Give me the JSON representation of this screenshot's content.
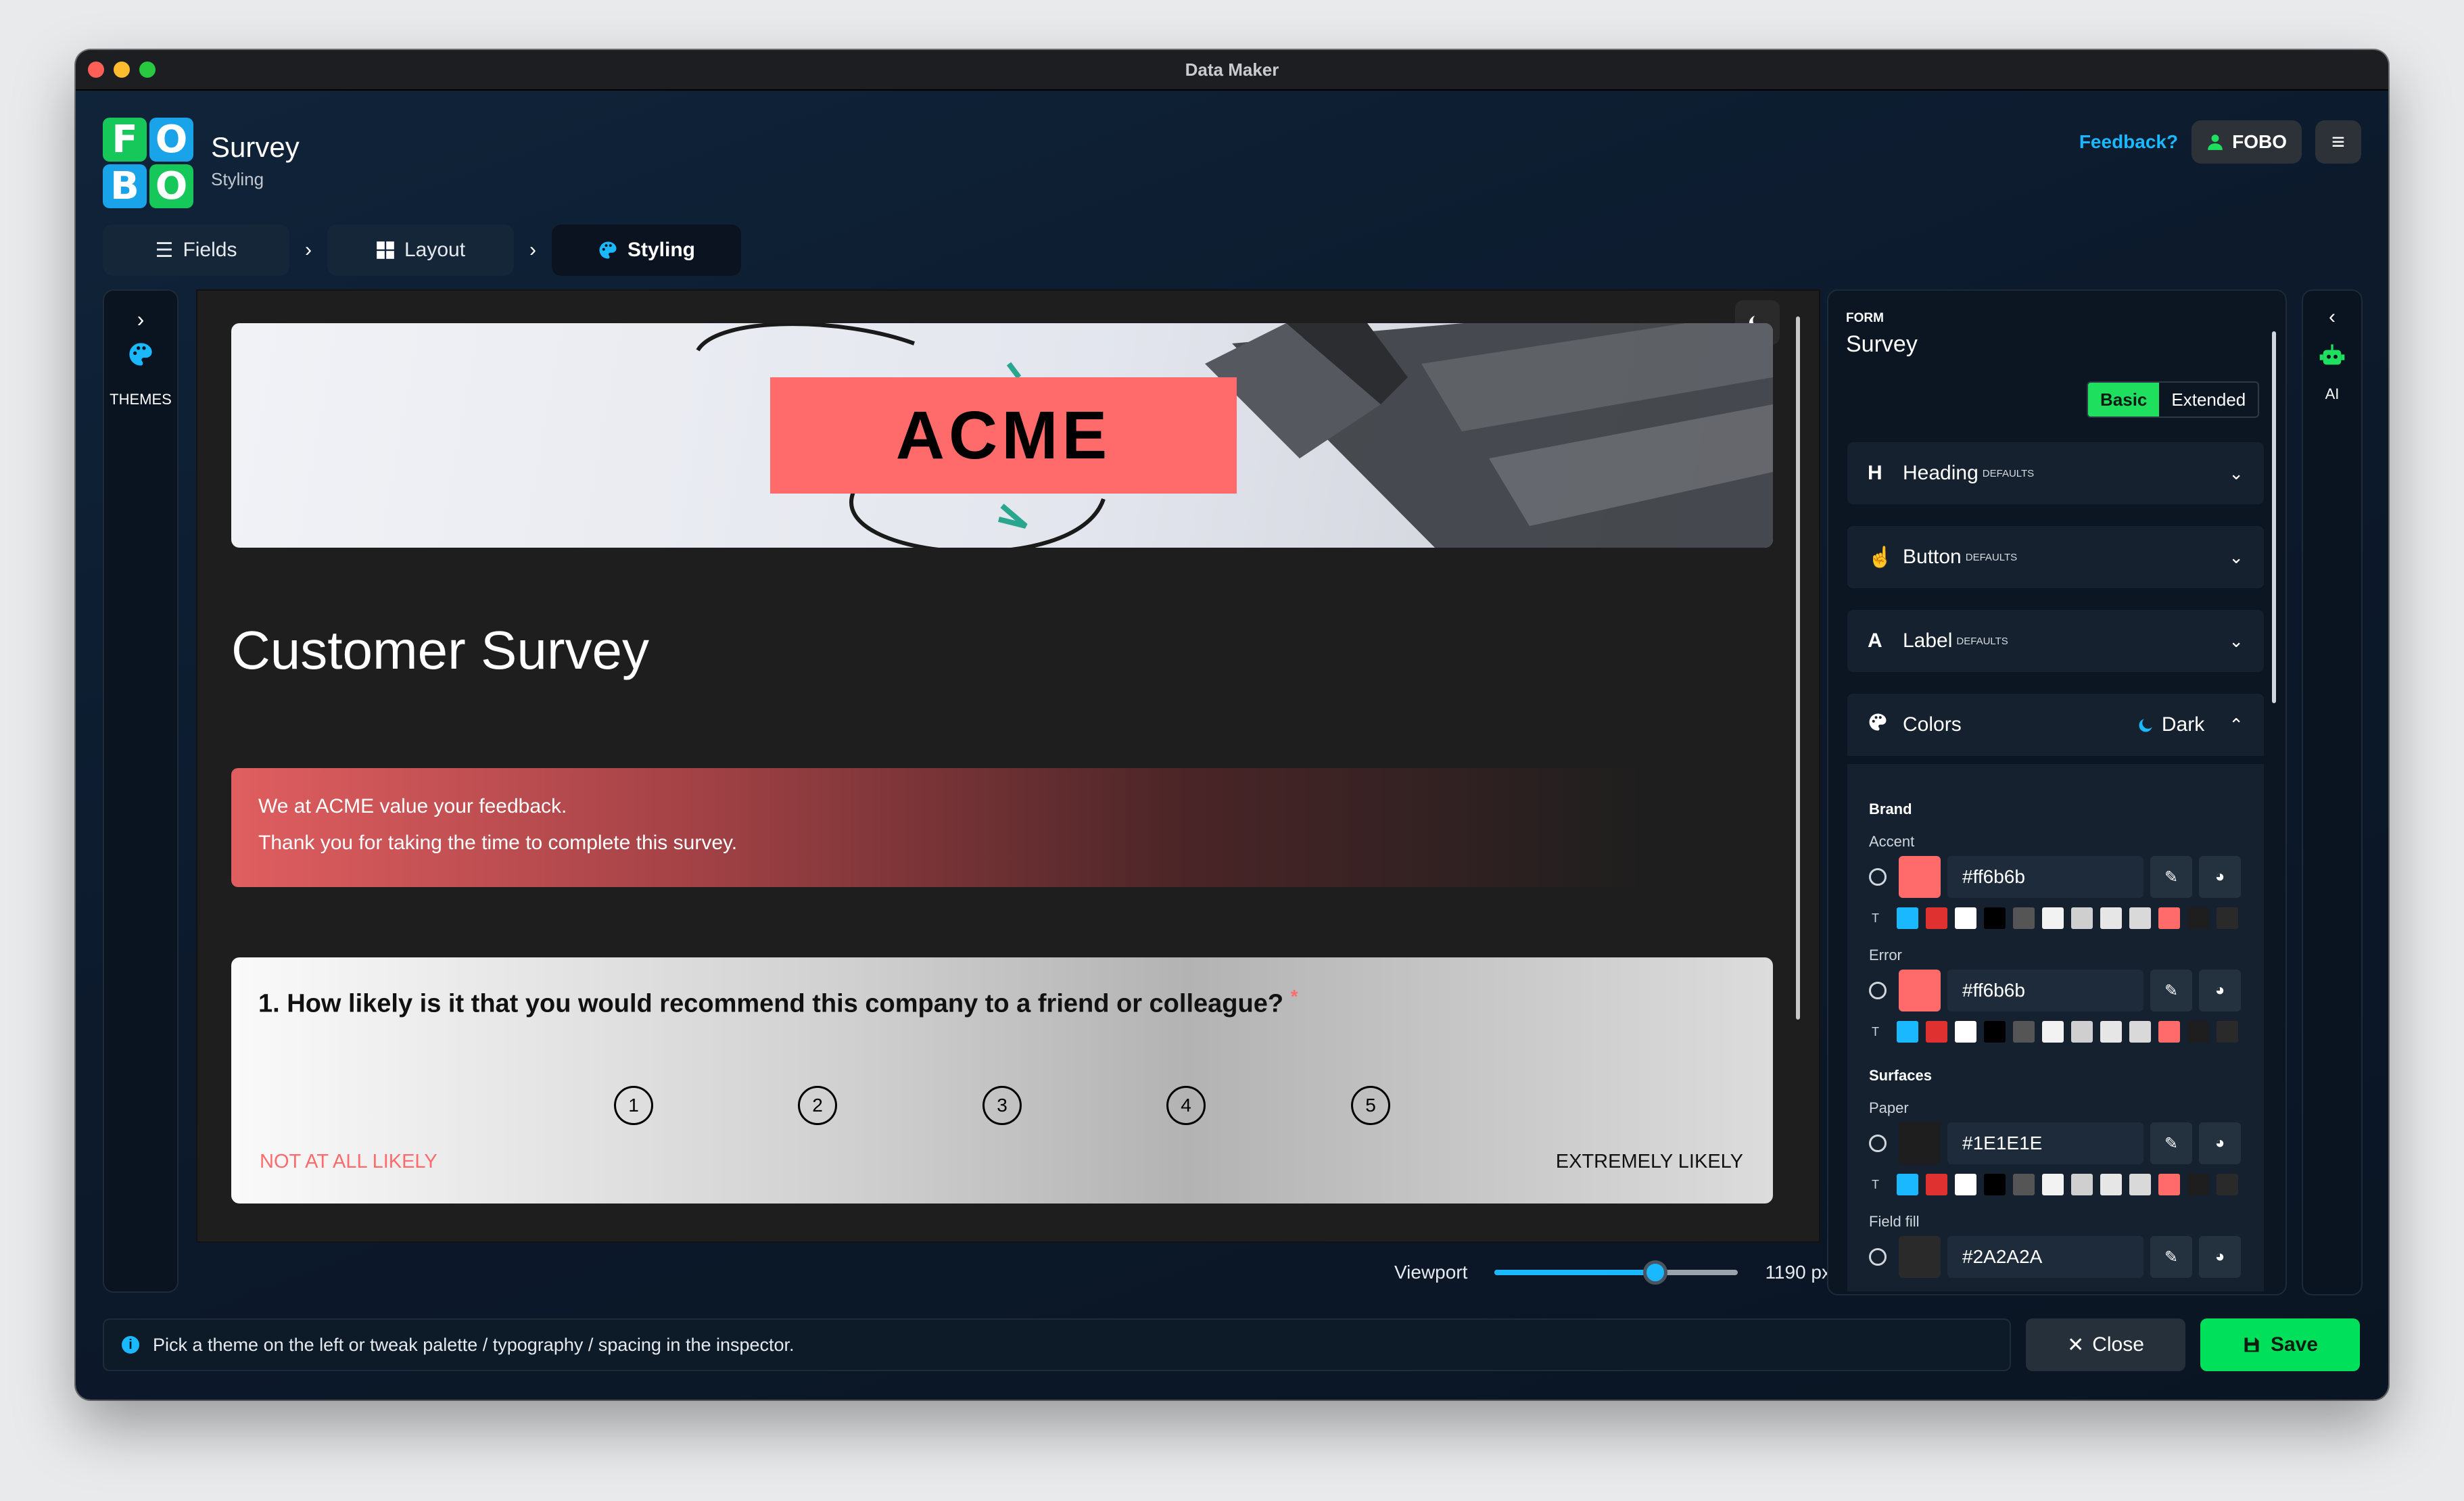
{
  "window": {
    "title": "Data Maker"
  },
  "app": {
    "logo_letters": [
      "F",
      "O",
      "B",
      "O"
    ],
    "name": "Survey",
    "subtitle": "Styling"
  },
  "header": {
    "feedback_label": "Feedback?",
    "user_label": "FOBO",
    "user_icon": "user-icon",
    "menu_icon": "hamburger-icon"
  },
  "steps": [
    {
      "label": "Fields",
      "icon": "list-icon"
    },
    {
      "label": "Layout",
      "icon": "grid-icon"
    },
    {
      "label": "Styling",
      "icon": "palette-icon",
      "active": true
    }
  ],
  "left_rail": {
    "label": "THEMES",
    "icon": "palette-icon"
  },
  "right_rail": {
    "label": "AI",
    "icon": "robot-icon"
  },
  "preview": {
    "banner_text": "ACME",
    "form_title": "Customer Survey",
    "notice_lines": [
      "We at ACME value your feedback.",
      "Thank you for taking the time to complete this survey."
    ],
    "question": {
      "text": "1. How likely is it that you would recommend this company to a friend or colleague?",
      "required_mark": "*",
      "options": [
        "1",
        "2",
        "3",
        "4",
        "5"
      ],
      "low_label": "NOT AT ALL LIKELY",
      "high_label": "EXTREMELY LIKELY"
    }
  },
  "viewport": {
    "label": "Viewport",
    "value_label": "1190 px",
    "fraction": 0.66
  },
  "inspector": {
    "kicker": "FORM",
    "title": "Survey",
    "modes": [
      "Basic",
      "Extended"
    ],
    "active_mode": "Basic",
    "sections": [
      {
        "label": "Heading",
        "badge": "DEFAULTS",
        "icon": "heading-icon"
      },
      {
        "label": "Button",
        "badge": "DEFAULTS",
        "icon": "pointer-icon"
      },
      {
        "label": "Label",
        "badge": "DEFAULTS",
        "icon": "letter-a-icon"
      }
    ],
    "colors": {
      "label": "Colors",
      "scheme_label": "Dark",
      "groups": [
        {
          "label": "Brand"
        },
        {
          "label": "Surfaces"
        }
      ],
      "rows": [
        {
          "label": "Accent",
          "value": "#ff6b6b",
          "swatch": "#ff6b6b"
        },
        {
          "label": "Error",
          "value": "#ff6b6b",
          "swatch": "#ff6b6b"
        },
        {
          "label": "Paper",
          "value": "#1E1E1E",
          "swatch": "#1e1e1e"
        },
        {
          "label": "Field fill",
          "value": "#2A2A2A",
          "swatch": "#2a2a2a"
        }
      ],
      "palette_prefix": "T",
      "palette": [
        "#1ab8ff",
        "#e03131",
        "#ffffff",
        "#000000",
        "#555555",
        "#f2f2f2",
        "#cfcfcf",
        "#e6e6e6",
        "#d9d9d9",
        "#ff6b6b",
        "#1e1e1e",
        "#2a2a2a"
      ]
    }
  },
  "status": {
    "message": "Pick a theme on the left or tweak palette / typography / spacing in the inspector."
  },
  "actions": {
    "close_label": "Close",
    "save_label": "Save"
  },
  "theme": {
    "accent": "#1ab8ff",
    "success": "#00e05a",
    "brand_red": "#ff6b6b"
  }
}
